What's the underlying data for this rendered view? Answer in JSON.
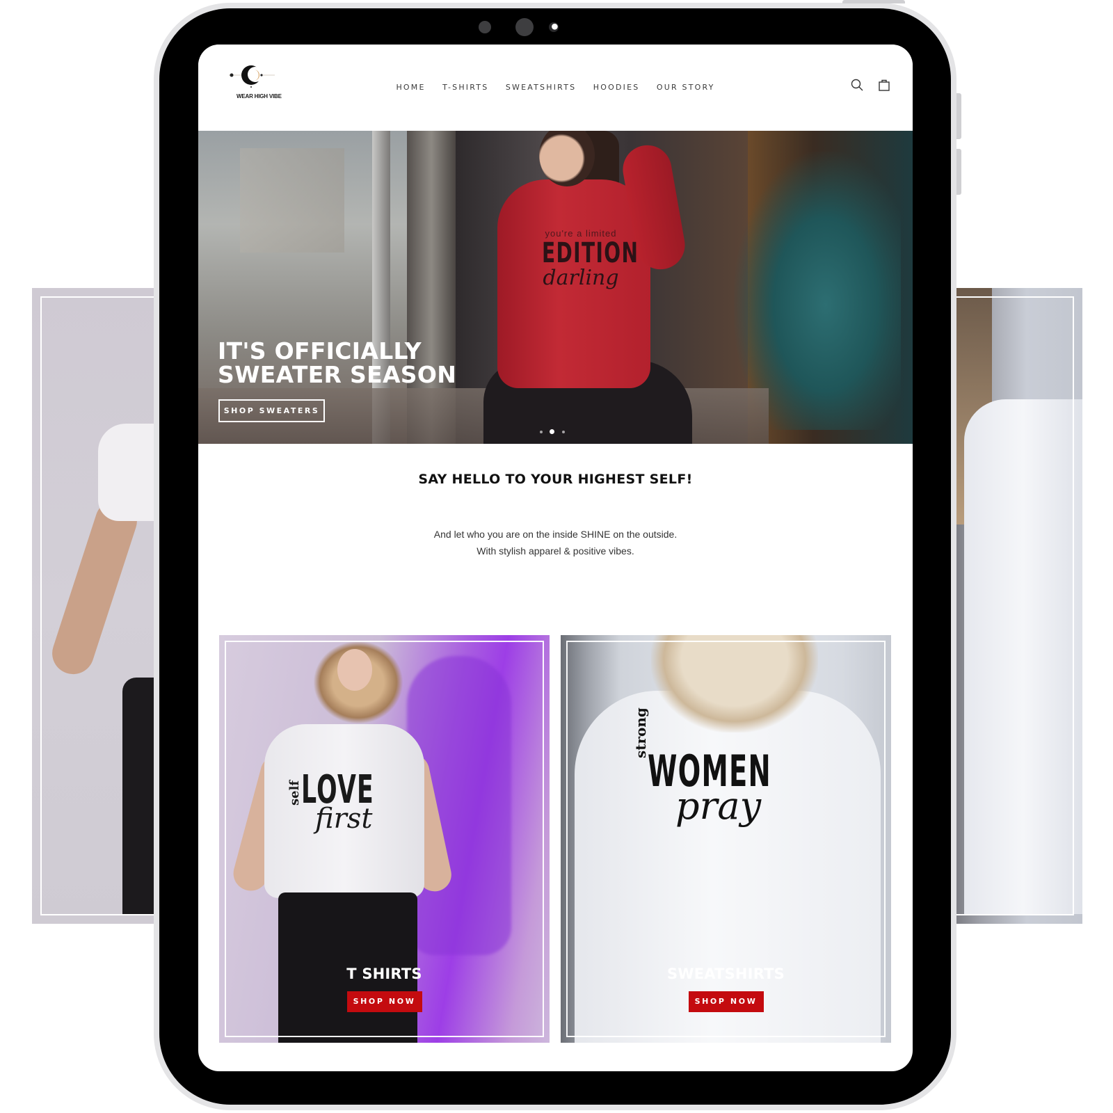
{
  "store": {
    "logo_text": "WEAR HIGH VIBE"
  },
  "nav": {
    "items": [
      {
        "label": "HOME"
      },
      {
        "label": "T-SHIRTS"
      },
      {
        "label": "SWEATSHIRTS"
      },
      {
        "label": "HOODIES"
      },
      {
        "label": "OUR STORY"
      }
    ],
    "icons": [
      "search-icon",
      "shopping-bag-icon"
    ]
  },
  "hero": {
    "title_line1": "IT'S OFFICIALLY",
    "title_line2": "SWEATER SEASON",
    "button_label": "SHOP SWEATERS",
    "slide_count": 3,
    "active_slide": 2,
    "shirt_print": {
      "small": "you're a limited",
      "big": "EDITION",
      "script": "darling"
    },
    "colors": {
      "sweater": "#b3212d",
      "tree": "#1f5659"
    }
  },
  "intro": {
    "title": "SAY HELLO TO YOUR HIGHEST SELF!",
    "line1": "And let who you are on the inside SHINE on the outside.",
    "line2": "With stylish apparel & positive vibes."
  },
  "categories": [
    {
      "title": "T SHIRTS",
      "button_label": "SHOP NOW",
      "print": {
        "side": "self",
        "big": "LOVE",
        "script": "first"
      }
    },
    {
      "title": "SWEATSHIRTS",
      "button_label": "SHOP NOW",
      "print": {
        "side": "strong",
        "big": "WOMEN",
        "script": "pray"
      }
    }
  ],
  "colors": {
    "button_red": "#c40b0f",
    "text_dark": "#111111",
    "nav_text": "#3a3a3a",
    "accent_purple": "#9d3ee6"
  }
}
